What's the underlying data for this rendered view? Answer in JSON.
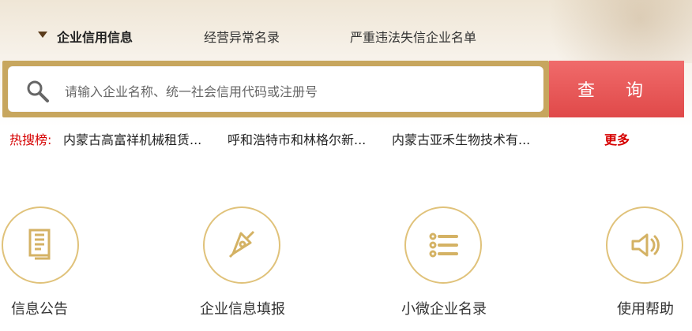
{
  "nav": {
    "tabs": [
      {
        "label": "企业信用信息"
      },
      {
        "label": "经营异常名录"
      },
      {
        "label": "严重违法失信企业名单"
      }
    ]
  },
  "search": {
    "placeholder": "请输入企业名称、统一社会信用代码或注册号",
    "button_label": "查 询"
  },
  "hot": {
    "label": "热搜榜:",
    "items": [
      "内蒙古高富祥机械租赁...",
      "呼和浩特市和林格尔新...",
      "内蒙古亚禾生物技术有..."
    ],
    "more_label": "更多"
  },
  "features": [
    {
      "label": "信息公告",
      "icon": "document-icon"
    },
    {
      "label": "企业信息填报",
      "icon": "pen-nib-icon"
    },
    {
      "label": "小微企业名录",
      "icon": "list-icon"
    },
    {
      "label": "使用帮助",
      "icon": "speaker-icon"
    }
  ],
  "colors": {
    "accent_gold": "#c7a65e",
    "button_red": "#e04949",
    "hot_red": "#d60000",
    "icon_gold": "#e0c27a"
  }
}
